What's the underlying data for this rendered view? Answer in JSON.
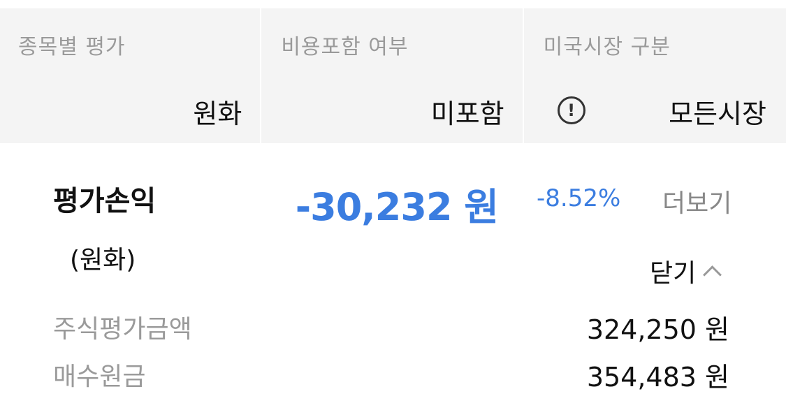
{
  "filters": {
    "evaluation": {
      "label": "종목별 평가",
      "value": "원화"
    },
    "fees": {
      "label": "비용포함 여부",
      "value": "미포함"
    },
    "market": {
      "label": "미국시장 구분",
      "value": "모든시장",
      "icon": "info-icon"
    }
  },
  "summary": {
    "title": "평가손익",
    "subtitle": "(원화)",
    "amount": "-30,232 원",
    "rate": "-8.52%",
    "more_label": "더보기",
    "close_label": "닫기",
    "accent_color": "#3b7de0"
  },
  "details": [
    {
      "label": "주식평가금액",
      "value": "324,250 원"
    },
    {
      "label": "매수원금",
      "value": "354,483 원"
    }
  ]
}
